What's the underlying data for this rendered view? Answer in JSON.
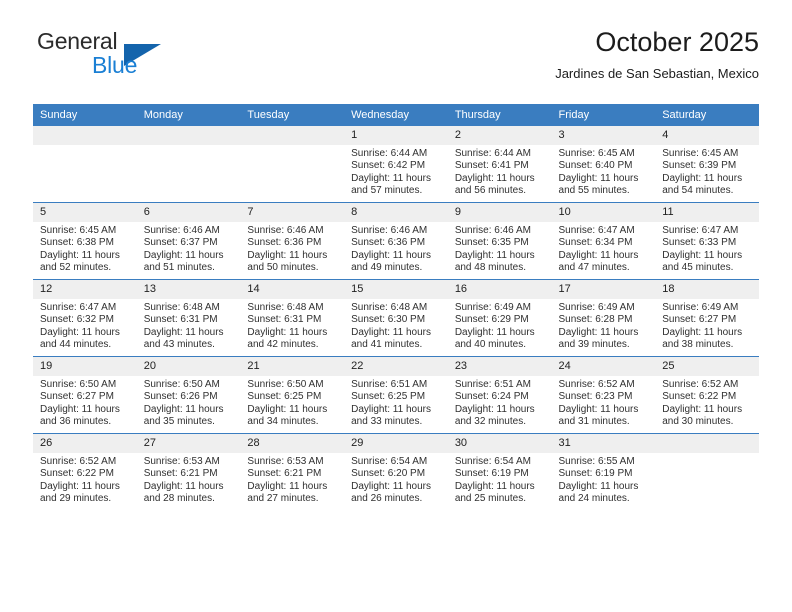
{
  "brand": {
    "name_top": "General",
    "name_bottom": "Blue",
    "accent_blue": "#1a7fd4",
    "triangle_blue": "#1464ac"
  },
  "header": {
    "title": "October 2025",
    "subtitle": "Jardines de San Sebastian, Mexico",
    "header_bg": "#3a7dc0",
    "daynum_bg": "#efefef"
  },
  "weekdays": [
    "Sunday",
    "Monday",
    "Tuesday",
    "Wednesday",
    "Thursday",
    "Friday",
    "Saturday"
  ],
  "weeks": [
    [
      {
        "day": "",
        "sunrise": "",
        "sunset": "",
        "daylight1": "",
        "daylight2": ""
      },
      {
        "day": "",
        "sunrise": "",
        "sunset": "",
        "daylight1": "",
        "daylight2": ""
      },
      {
        "day": "",
        "sunrise": "",
        "sunset": "",
        "daylight1": "",
        "daylight2": ""
      },
      {
        "day": "1",
        "sunrise": "Sunrise: 6:44 AM",
        "sunset": "Sunset: 6:42 PM",
        "daylight1": "Daylight: 11 hours",
        "daylight2": "and 57 minutes."
      },
      {
        "day": "2",
        "sunrise": "Sunrise: 6:44 AM",
        "sunset": "Sunset: 6:41 PM",
        "daylight1": "Daylight: 11 hours",
        "daylight2": "and 56 minutes."
      },
      {
        "day": "3",
        "sunrise": "Sunrise: 6:45 AM",
        "sunset": "Sunset: 6:40 PM",
        "daylight1": "Daylight: 11 hours",
        "daylight2": "and 55 minutes."
      },
      {
        "day": "4",
        "sunrise": "Sunrise: 6:45 AM",
        "sunset": "Sunset: 6:39 PM",
        "daylight1": "Daylight: 11 hours",
        "daylight2": "and 54 minutes."
      }
    ],
    [
      {
        "day": "5",
        "sunrise": "Sunrise: 6:45 AM",
        "sunset": "Sunset: 6:38 PM",
        "daylight1": "Daylight: 11 hours",
        "daylight2": "and 52 minutes."
      },
      {
        "day": "6",
        "sunrise": "Sunrise: 6:46 AM",
        "sunset": "Sunset: 6:37 PM",
        "daylight1": "Daylight: 11 hours",
        "daylight2": "and 51 minutes."
      },
      {
        "day": "7",
        "sunrise": "Sunrise: 6:46 AM",
        "sunset": "Sunset: 6:36 PM",
        "daylight1": "Daylight: 11 hours",
        "daylight2": "and 50 minutes."
      },
      {
        "day": "8",
        "sunrise": "Sunrise: 6:46 AM",
        "sunset": "Sunset: 6:36 PM",
        "daylight1": "Daylight: 11 hours",
        "daylight2": "and 49 minutes."
      },
      {
        "day": "9",
        "sunrise": "Sunrise: 6:46 AM",
        "sunset": "Sunset: 6:35 PM",
        "daylight1": "Daylight: 11 hours",
        "daylight2": "and 48 minutes."
      },
      {
        "day": "10",
        "sunrise": "Sunrise: 6:47 AM",
        "sunset": "Sunset: 6:34 PM",
        "daylight1": "Daylight: 11 hours",
        "daylight2": "and 47 minutes."
      },
      {
        "day": "11",
        "sunrise": "Sunrise: 6:47 AM",
        "sunset": "Sunset: 6:33 PM",
        "daylight1": "Daylight: 11 hours",
        "daylight2": "and 45 minutes."
      }
    ],
    [
      {
        "day": "12",
        "sunrise": "Sunrise: 6:47 AM",
        "sunset": "Sunset: 6:32 PM",
        "daylight1": "Daylight: 11 hours",
        "daylight2": "and 44 minutes."
      },
      {
        "day": "13",
        "sunrise": "Sunrise: 6:48 AM",
        "sunset": "Sunset: 6:31 PM",
        "daylight1": "Daylight: 11 hours",
        "daylight2": "and 43 minutes."
      },
      {
        "day": "14",
        "sunrise": "Sunrise: 6:48 AM",
        "sunset": "Sunset: 6:31 PM",
        "daylight1": "Daylight: 11 hours",
        "daylight2": "and 42 minutes."
      },
      {
        "day": "15",
        "sunrise": "Sunrise: 6:48 AM",
        "sunset": "Sunset: 6:30 PM",
        "daylight1": "Daylight: 11 hours",
        "daylight2": "and 41 minutes."
      },
      {
        "day": "16",
        "sunrise": "Sunrise: 6:49 AM",
        "sunset": "Sunset: 6:29 PM",
        "daylight1": "Daylight: 11 hours",
        "daylight2": "and 40 minutes."
      },
      {
        "day": "17",
        "sunrise": "Sunrise: 6:49 AM",
        "sunset": "Sunset: 6:28 PM",
        "daylight1": "Daylight: 11 hours",
        "daylight2": "and 39 minutes."
      },
      {
        "day": "18",
        "sunrise": "Sunrise: 6:49 AM",
        "sunset": "Sunset: 6:27 PM",
        "daylight1": "Daylight: 11 hours",
        "daylight2": "and 38 minutes."
      }
    ],
    [
      {
        "day": "19",
        "sunrise": "Sunrise: 6:50 AM",
        "sunset": "Sunset: 6:27 PM",
        "daylight1": "Daylight: 11 hours",
        "daylight2": "and 36 minutes."
      },
      {
        "day": "20",
        "sunrise": "Sunrise: 6:50 AM",
        "sunset": "Sunset: 6:26 PM",
        "daylight1": "Daylight: 11 hours",
        "daylight2": "and 35 minutes."
      },
      {
        "day": "21",
        "sunrise": "Sunrise: 6:50 AM",
        "sunset": "Sunset: 6:25 PM",
        "daylight1": "Daylight: 11 hours",
        "daylight2": "and 34 minutes."
      },
      {
        "day": "22",
        "sunrise": "Sunrise: 6:51 AM",
        "sunset": "Sunset: 6:25 PM",
        "daylight1": "Daylight: 11 hours",
        "daylight2": "and 33 minutes."
      },
      {
        "day": "23",
        "sunrise": "Sunrise: 6:51 AM",
        "sunset": "Sunset: 6:24 PM",
        "daylight1": "Daylight: 11 hours",
        "daylight2": "and 32 minutes."
      },
      {
        "day": "24",
        "sunrise": "Sunrise: 6:52 AM",
        "sunset": "Sunset: 6:23 PM",
        "daylight1": "Daylight: 11 hours",
        "daylight2": "and 31 minutes."
      },
      {
        "day": "25",
        "sunrise": "Sunrise: 6:52 AM",
        "sunset": "Sunset: 6:22 PM",
        "daylight1": "Daylight: 11 hours",
        "daylight2": "and 30 minutes."
      }
    ],
    [
      {
        "day": "26",
        "sunrise": "Sunrise: 6:52 AM",
        "sunset": "Sunset: 6:22 PM",
        "daylight1": "Daylight: 11 hours",
        "daylight2": "and 29 minutes."
      },
      {
        "day": "27",
        "sunrise": "Sunrise: 6:53 AM",
        "sunset": "Sunset: 6:21 PM",
        "daylight1": "Daylight: 11 hours",
        "daylight2": "and 28 minutes."
      },
      {
        "day": "28",
        "sunrise": "Sunrise: 6:53 AM",
        "sunset": "Sunset: 6:21 PM",
        "daylight1": "Daylight: 11 hours",
        "daylight2": "and 27 minutes."
      },
      {
        "day": "29",
        "sunrise": "Sunrise: 6:54 AM",
        "sunset": "Sunset: 6:20 PM",
        "daylight1": "Daylight: 11 hours",
        "daylight2": "and 26 minutes."
      },
      {
        "day": "30",
        "sunrise": "Sunrise: 6:54 AM",
        "sunset": "Sunset: 6:19 PM",
        "daylight1": "Daylight: 11 hours",
        "daylight2": "and 25 minutes."
      },
      {
        "day": "31",
        "sunrise": "Sunrise: 6:55 AM",
        "sunset": "Sunset: 6:19 PM",
        "daylight1": "Daylight: 11 hours",
        "daylight2": "and 24 minutes."
      },
      {
        "day": "",
        "sunrise": "",
        "sunset": "",
        "daylight1": "",
        "daylight2": ""
      }
    ]
  ]
}
